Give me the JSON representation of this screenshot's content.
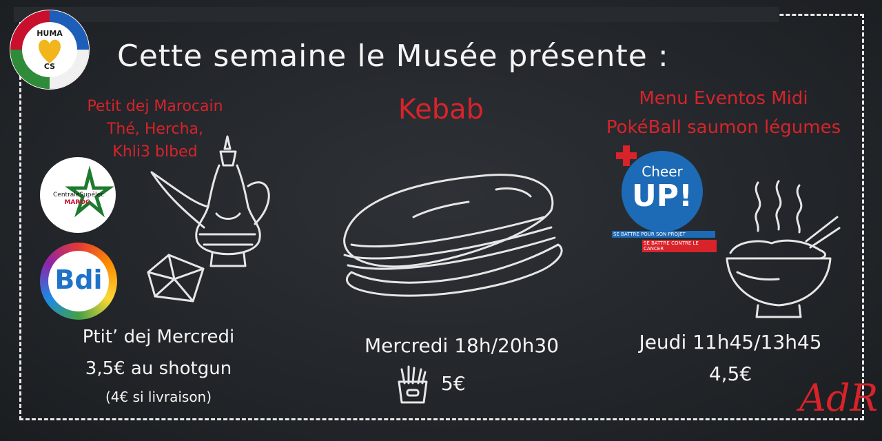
{
  "title": "Cette semaine le Musée présente :",
  "logos": {
    "huma": {
      "line1": "HUMA",
      "line2": "CS"
    },
    "maroc": {
      "line1": "CentraleSupélec",
      "line2": "MAROC"
    },
    "bdi": {
      "text": "Bdi"
    },
    "cheerup": {
      "top": "Cheer",
      "big": "UP!",
      "tag1": "SE BATTRE POUR SON PROJET",
      "tag2": "SE BATTRE CONTRE LE CANCER"
    },
    "signature": "AdR"
  },
  "left": {
    "heading": [
      "Petit dej Marocain",
      "Thé, Hercha,",
      "Khli3 blbed"
    ],
    "day": "Ptit’ dej Mercredi",
    "price": "3,5€ au shotgun",
    "note": "(4€ si livraison)"
  },
  "center": {
    "heading": "Kebab",
    "schedule": "Mercredi 18h/20h30",
    "price": "5€"
  },
  "right": {
    "heading": [
      "Menu Eventos Midi",
      "PokéBall saumon légumes"
    ],
    "schedule": "Jeudi  11h45/13h45",
    "price": "4,5€"
  },
  "icons": [
    "teapot-icon",
    "msemen-icon",
    "sandwich-icon",
    "fries-icon",
    "bowl-icon"
  ],
  "colors": {
    "accent": "#d8232a",
    "background": "#272b2f",
    "chalk": "#f2f2f2"
  }
}
